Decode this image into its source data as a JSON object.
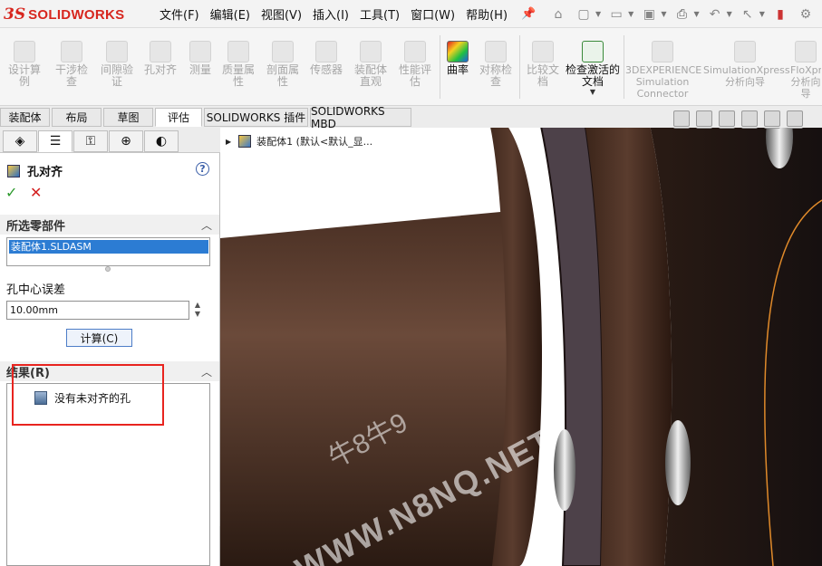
{
  "app": {
    "logo_ds": "3S",
    "logo_brand": "SOLIDWORKS"
  },
  "menu": [
    "文件(F)",
    "编辑(E)",
    "视图(V)",
    "插入(I)",
    "工具(T)",
    "窗口(W)",
    "帮助(H)"
  ],
  "ribbon": [
    {
      "label": "设计算例",
      "active": false
    },
    {
      "label": "干涉检查",
      "active": false
    },
    {
      "label": "间隙验证",
      "active": false
    },
    {
      "label": "孔对齐",
      "active": false
    },
    {
      "label": "测量",
      "active": false
    },
    {
      "label": "质量属性",
      "active": false
    },
    {
      "label": "剖面属性",
      "active": false
    },
    {
      "label": "传感器",
      "active": false
    },
    {
      "label": "装配体直观",
      "active": false
    },
    {
      "label": "性能评估",
      "active": false
    },
    {
      "label": "曲率",
      "active": true
    },
    {
      "label": "对称检查",
      "active": false
    },
    {
      "label": "比较文档",
      "active": false
    },
    {
      "label": "检查激活的文档",
      "active": true
    },
    {
      "label": "3DEXPERIENCE Simulation Connector",
      "active": false
    },
    {
      "label": "SimulationXpress 分析向导",
      "active": false
    },
    {
      "label": "FloXpress 分析向导",
      "active": false
    }
  ],
  "tabs": [
    {
      "label": "装配体"
    },
    {
      "label": "布局"
    },
    {
      "label": "草图"
    },
    {
      "label": "评估"
    },
    {
      "label": "SOLIDWORKS 插件"
    },
    {
      "label": "SOLIDWORKS MBD"
    }
  ],
  "property_manager": {
    "title": "孔对齐",
    "help": "?",
    "ok": "✓",
    "cancel": "✕",
    "group_selected": "所选零部件",
    "selected_item": "装配体1.SLDASM",
    "tolerance_label": "孔中心误差",
    "tolerance_value": "10.00mm",
    "calc_button": "计算(C)",
    "group_results": "结果(R)",
    "result_text": "没有未对齐的孔"
  },
  "viewport": {
    "tree_label": "装配体1  (默认<默认_显...",
    "watermark_top": "牛8牛9",
    "watermark_bottom": "WWW.N8NQ.NET"
  },
  "colors": {
    "accent": "#2c7cd3",
    "highlight_box": "#e8241f",
    "model_dark": "#3a2419",
    "model_light": "#6b4a3a"
  }
}
